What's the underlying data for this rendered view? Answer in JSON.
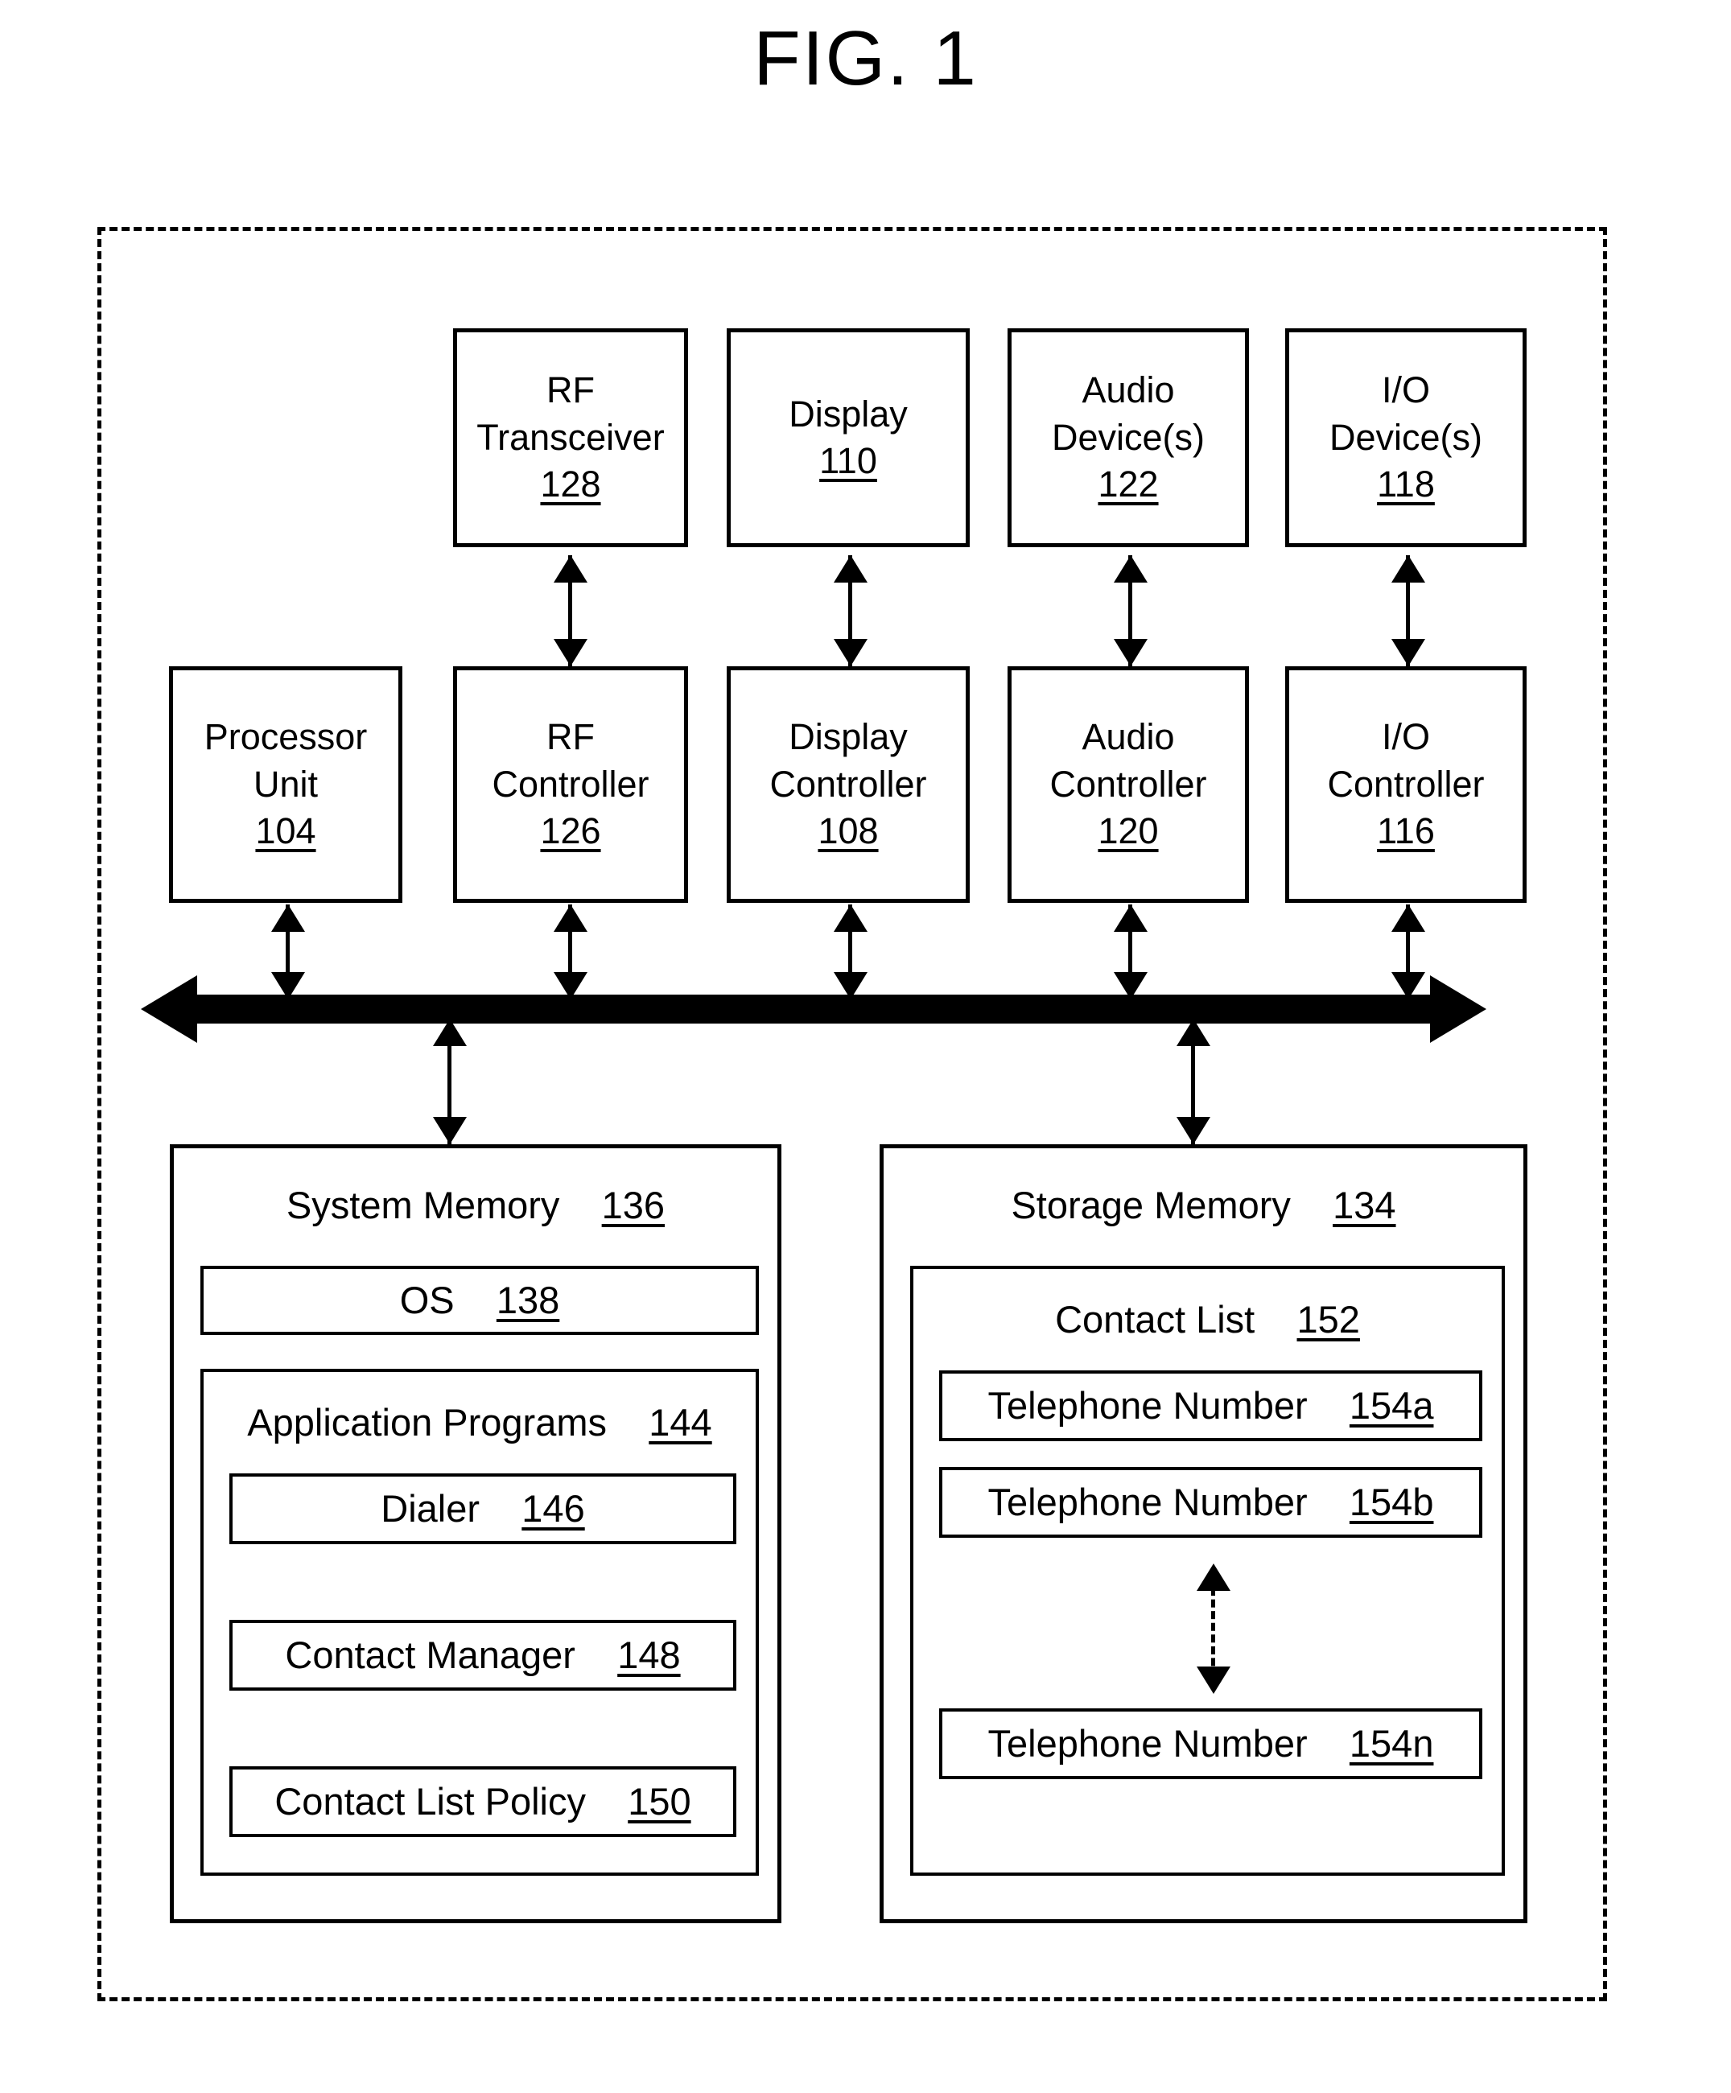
{
  "figure": {
    "title": "FIG. 1"
  },
  "peripherals": [
    {
      "name": "rf-transceiver",
      "line1": "RF",
      "line2": "Transceiver",
      "ref": "128"
    },
    {
      "name": "display",
      "line1": "Display",
      "line2": "",
      "ref": "110"
    },
    {
      "name": "audio-devices",
      "line1": "Audio",
      "line2": "Device(s)",
      "ref": "122"
    },
    {
      "name": "io-devices",
      "line1": "I/O",
      "line2": "Device(s)",
      "ref": "118"
    }
  ],
  "controllers": [
    {
      "name": "processor-unit",
      "line1": "Processor",
      "line2": "Unit",
      "ref": "104"
    },
    {
      "name": "rf-controller",
      "line1": "RF",
      "line2": "Controller",
      "ref": "126"
    },
    {
      "name": "display-controller",
      "line1": "Display",
      "line2": "Controller",
      "ref": "108"
    },
    {
      "name": "audio-controller",
      "line1": "Audio",
      "line2": "Controller",
      "ref": "120"
    },
    {
      "name": "io-controller",
      "line1": "I/O",
      "line2": "Controller",
      "ref": "116"
    }
  ],
  "bus": {
    "label": ""
  },
  "system_memory": {
    "title": "System Memory",
    "ref": "136",
    "os": {
      "title": "OS",
      "ref": "138"
    },
    "application_programs": {
      "title": "Application Programs",
      "ref": "144",
      "items": [
        {
          "title": "Dialer",
          "ref": "146"
        },
        {
          "title": "Contact Manager",
          "ref": "148"
        },
        {
          "title": "Contact List Policy",
          "ref": "150"
        }
      ]
    }
  },
  "storage_memory": {
    "title": "Storage Memory",
    "ref": "134",
    "contact_list": {
      "title": "Contact List",
      "ref": "152",
      "entries": [
        {
          "title": "Telephone Number",
          "ref": "154a"
        },
        {
          "title": "Telephone Number",
          "ref": "154b"
        },
        {
          "title": "Telephone Number",
          "ref": "154n"
        }
      ]
    }
  },
  "colors": {
    "stroke": "#000000",
    "background": "#ffffff"
  }
}
